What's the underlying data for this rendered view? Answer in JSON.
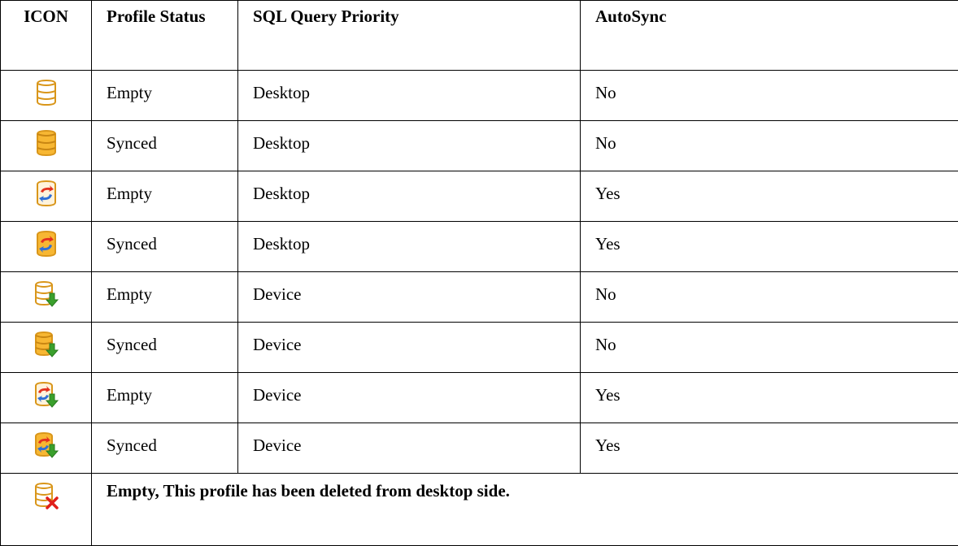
{
  "headers": {
    "icon": "ICON",
    "status": "Profile Status",
    "priority": "SQL Query Priority",
    "autosync": "AutoSync"
  },
  "rows": [
    {
      "icon": "db-empty-icon",
      "status": "Empty",
      "priority": "Desktop",
      "autosync": "No"
    },
    {
      "icon": "db-synced-icon",
      "status": "Synced",
      "priority": "Desktop",
      "autosync": "No"
    },
    {
      "icon": "db-empty-autosync-icon",
      "status": "Empty",
      "priority": "Desktop",
      "autosync": "Yes"
    },
    {
      "icon": "db-synced-autosync-icon",
      "status": "Synced",
      "priority": "Desktop",
      "autosync": "Yes"
    },
    {
      "icon": "db-empty-device-icon",
      "status": "Empty",
      "priority": "Device",
      "autosync": "No"
    },
    {
      "icon": "db-synced-device-icon",
      "status": "Synced",
      "priority": "Device",
      "autosync": "No"
    },
    {
      "icon": "db-empty-autosync-device-icon",
      "status": "Empty",
      "priority": "Device",
      "autosync": "Yes"
    },
    {
      "icon": "db-synced-autosync-device-icon",
      "status": "Synced",
      "priority": "Device",
      "autosync": "Yes"
    }
  ],
  "deleted_row": {
    "icon": "db-deleted-icon",
    "note": "Empty, This profile has been deleted from desktop side."
  },
  "colors": {
    "border": "#000000",
    "db_outline": "#d9961a",
    "db_fill": "#f7b733",
    "sync_red": "#e2311f",
    "sync_blue": "#2f6fd6",
    "arrow_green": "#3aa02c",
    "delete_red": "#e0201b"
  }
}
